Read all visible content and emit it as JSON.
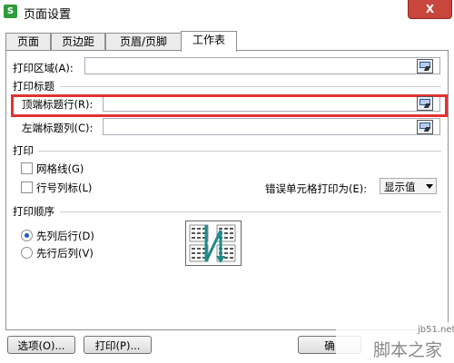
{
  "window": {
    "title": "页面设置",
    "app_icon_glyph": "S",
    "close_label": "X"
  },
  "tabs": [
    {
      "label": "页面",
      "active": false
    },
    {
      "label": "页边距",
      "active": false
    },
    {
      "label": "页眉/页脚",
      "active": false
    },
    {
      "label": "工作表",
      "active": true
    }
  ],
  "sheet": {
    "print_area_label": "打印区域(A):",
    "print_area_value": "",
    "print_titles_head": "打印标题",
    "top_rows_label": "顶端标题行(R):",
    "top_rows_value": "",
    "left_cols_label": "左端标题列(C):",
    "left_cols_value": "",
    "print_head": "打印",
    "gridlines_label": "网格线(G)",
    "gridlines_checked": false,
    "row_col_headers_label": "行号列标(L)",
    "row_col_headers_checked": false,
    "cell_errors_label": "错误单元格打印为(E):",
    "cell_errors_value": "显示值",
    "page_order_head": "打印顺序",
    "down_then_over_label": "先列后行(D)",
    "over_then_down_label": "先行后列(V)",
    "selected_order": "down_then_over"
  },
  "buttons": {
    "options": "选项(O)...",
    "print": "打印(P)...",
    "ok": "确"
  },
  "watermark": {
    "site": "jb51.net",
    "text": "脚本之家"
  },
  "colors": {
    "highlight": "#e23232",
    "accent": "#2e9c3c",
    "close": "#c9463d"
  }
}
